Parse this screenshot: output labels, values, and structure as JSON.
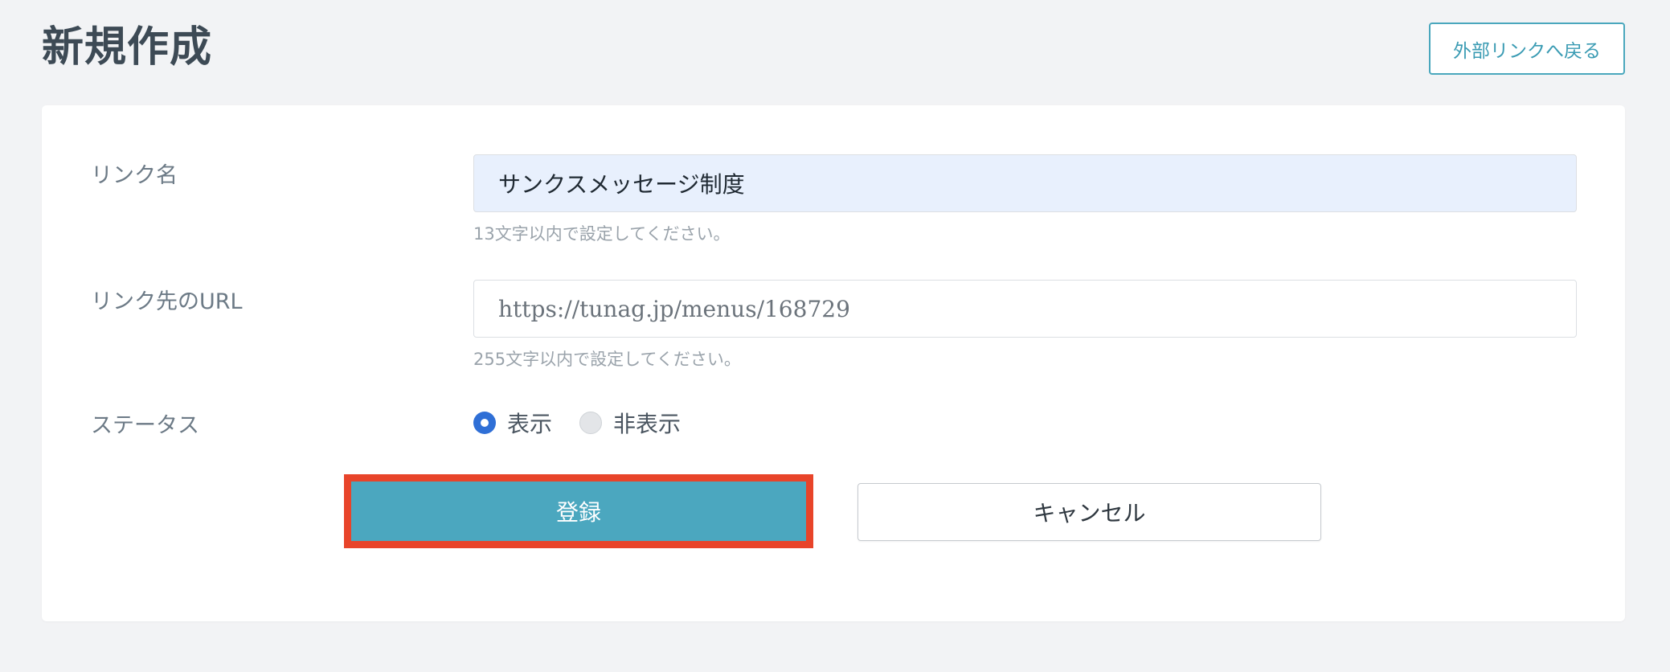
{
  "header": {
    "title": "新規作成",
    "back_link_label": "外部リンクへ戻る"
  },
  "form": {
    "link_name": {
      "label": "リンク名",
      "value": "サンクスメッセージ制度",
      "hint": "13文字以内で設定してください。"
    },
    "link_url": {
      "label": "リンク先のURL",
      "value": "https://tunag.jp/menus/168729",
      "hint": "255文字以内で設定してください。"
    },
    "status": {
      "label": "ステータス",
      "options": [
        {
          "label": "表示",
          "checked": true
        },
        {
          "label": "非表示",
          "checked": false
        }
      ]
    },
    "submit_label": "登録",
    "cancel_label": "キャンセル"
  },
  "colors": {
    "accent": "#4ba7bf",
    "highlight_border": "#e8442a",
    "radio_selected": "#2f6fd6"
  }
}
